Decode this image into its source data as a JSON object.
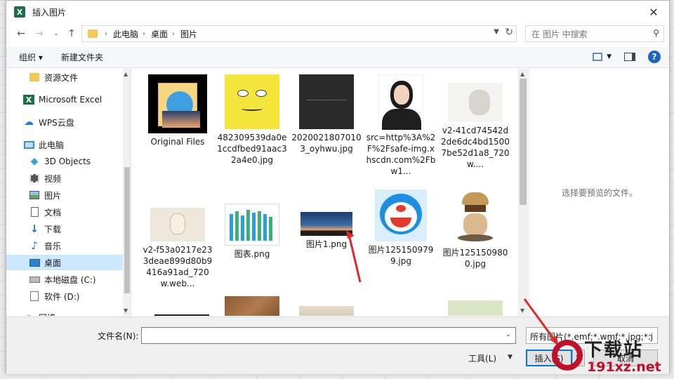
{
  "window": {
    "title": "插入图片",
    "app_icon_letter": "X"
  },
  "nav": {
    "breadcrumbs": [
      "此电脑",
      "桌面",
      "图片"
    ],
    "search_placeholder": "在 图片 中搜索"
  },
  "toolbar": {
    "organize_label": "组织 ▾",
    "new_folder_label": "新建文件夹",
    "help_label": "?"
  },
  "sidebar": {
    "items": [
      {
        "label": "资源文件",
        "icon": "folder-icon",
        "selected": false
      },
      {
        "label": "Microsoft Excel",
        "icon": "excel-icon",
        "selected": false
      },
      {
        "label": "WPS云盘",
        "icon": "cloud-icon",
        "selected": false
      },
      {
        "label": "此电脑",
        "icon": "computer-icon",
        "selected": false
      },
      {
        "label": "3D Objects",
        "icon": "cube-icon",
        "selected": false
      },
      {
        "label": "视频",
        "icon": "video-icon",
        "selected": false
      },
      {
        "label": "图片",
        "icon": "picture-icon",
        "selected": false
      },
      {
        "label": "文档",
        "icon": "document-icon",
        "selected": false
      },
      {
        "label": "下载",
        "icon": "download-icon",
        "selected": false
      },
      {
        "label": "音乐",
        "icon": "music-icon",
        "selected": false
      },
      {
        "label": "桌面",
        "icon": "desktop-icon",
        "selected": true
      },
      {
        "label": "本地磁盘 (C:)",
        "icon": "drive-icon",
        "selected": false
      },
      {
        "label": "软件 (D:)",
        "icon": "drive-icon",
        "selected": false
      },
      {
        "label": "网络",
        "icon": "network-icon",
        "selected": false
      }
    ]
  },
  "files": [
    {
      "name": "Original Files",
      "kind": "folder"
    },
    {
      "name": "482309539da0e1ccdfbed91aac32a4e0.jpg",
      "kind": "sponge"
    },
    {
      "name": "20200218070103_oyhwu.jpg",
      "kind": "dark"
    },
    {
      "name": "src=http%3A%2F%2Fsafe-img.xhscdn.com%2Fbw1...",
      "kind": "portrait"
    },
    {
      "name": "v2-41cd74542d2de6dc4bd15007be52d1a8_720w....",
      "kind": "photo"
    },
    {
      "name": "v2-f53a0217e233deae899d80b9416a91ad_720w.web...",
      "kind": "bottle"
    },
    {
      "name": "图表.png",
      "kind": "chart"
    },
    {
      "name": "图片1.png",
      "kind": "city"
    },
    {
      "name": "图片1251509799.jpg",
      "kind": "doraemon"
    },
    {
      "name": "图片1251509800.jpg",
      "kind": "burger"
    },
    {
      "name": "",
      "kind": "dark2"
    },
    {
      "name": "",
      "kind": "leather"
    },
    {
      "name": "",
      "kind": "beige"
    },
    {
      "name": "",
      "kind": "green"
    }
  ],
  "preview": {
    "text": "选择要预览的文件。"
  },
  "bottom": {
    "filename_label": "文件名(N):",
    "filename_value": "",
    "filetype_value": "所有图片(*.emf;*.wmf;*.jpg;*.j",
    "tools_label": "工具(L)",
    "insert_label": "插入(S)",
    "cancel_label": "取消"
  },
  "watermark": {
    "big": "下载站",
    "small": "191xz.net"
  },
  "colors": {
    "accent": "#0078d7",
    "selected_bg": "#cce8ff",
    "excel_green": "#1d7044",
    "watermark_red": "#c0112c"
  }
}
